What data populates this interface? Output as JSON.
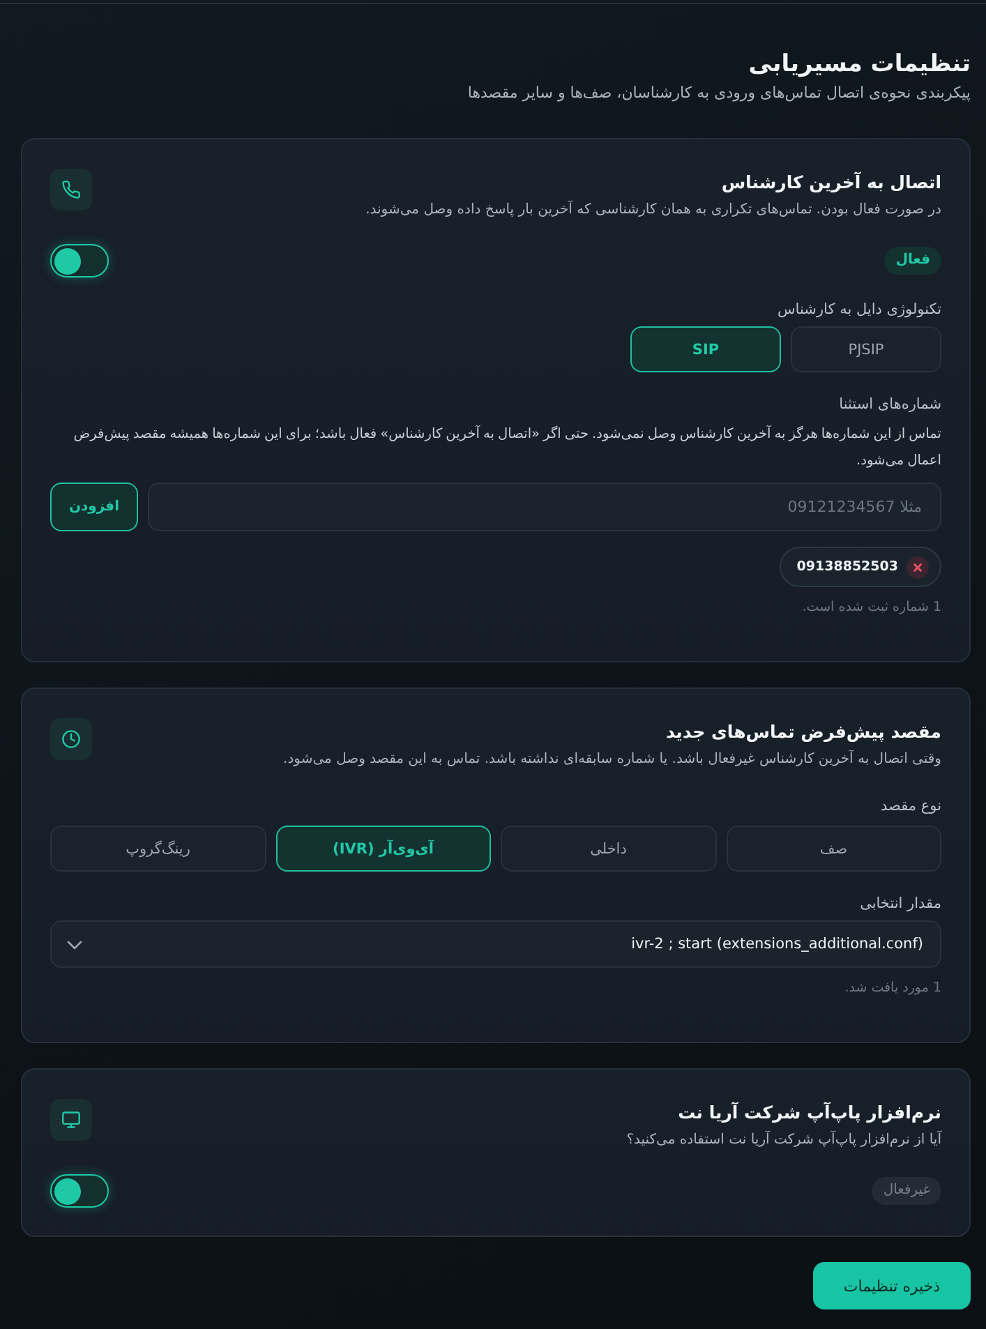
{
  "page": {
    "title": "تنظیمات مسیریابی",
    "subtitle": "پیکربندی نحوه‌ی اتصال تماس‌های ورودی به کارشناسان، صف‌ها و سایر مقصدها"
  },
  "cards": [
    {
      "title": "اتصال به آخرین کارشناس",
      "description": "در صورت فعال بودن. تماس‌های تکراری به همان کارشناسی که آخرین بار پاسخ داده وصل می‌شوند.",
      "sections": [
        {
          "kind": "toggle",
          "on": false,
          "active": true,
          "badge": "فعال"
        },
        {
          "kind": "choice",
          "label": "تکنولوژی دایل به کارشناس",
          "options": [
            {
              "label": "PJSIP",
              "selected": false
            },
            {
              "label": "SIP",
              "selected": true
            }
          ]
        },
        {
          "kind": "exceptions",
          "label": "شماره‌های استثنا",
          "help": "تماس از این شماره‌ها هرگز به آخرین کارشناس وصل نمی‌شود. حتی اگر «اتصال به آخرین کارشناس» فعال باشد؛ برای این شماره‌ها همیشه مقصد پیش‌فرض اعمال می‌شود.",
          "input": {
            "placeholder": "مثلا 09121234567"
          },
          "add_button": "افزودن",
          "numbers": [
            "09138852503"
          ],
          "note": "1 شماره ثبت شده است."
        }
      ]
    },
    {
      "title": "مقصد پیش‌فرض تماس‌های جدید",
      "description": "وقتی اتصال به آخرین کارشناس غیرفعال باشد. یا شماره سابقه‌ای نداشته باشد. تماس به این مقصد وصل می‌شود.",
      "sections": [
        {
          "kind": "choice",
          "label": "نوع مقصد",
          "options": [
            {
              "label": "صف",
              "selected": false
            },
            {
              "label": "داخلی",
              "selected": false
            },
            {
              "label": "آی‌وی‌آر (IVR)",
              "selected": true
            },
            {
              "label": "رینگ‌گروپ",
              "selected": false
            }
          ]
        },
        {
          "kind": "select",
          "label": "مقدار انتخابی",
          "value": "ivr-2 ; start (extensions_additional.conf)",
          "note": "1 مورد یافت شد."
        }
      ]
    },
    {
      "title": "نرم‌افزار پاپ‌آپ شرکت آریا نت",
      "description": "آیا از نرم‌افزار پاپ‌آپ شرکت آریا نت استفاده می‌کنید؟",
      "sections": [
        {
          "kind": "toggle",
          "on": false,
          "active": false,
          "badge": "غیرفعال"
        }
      ]
    }
  ],
  "save_button": "ذخیره تنظیمات"
}
